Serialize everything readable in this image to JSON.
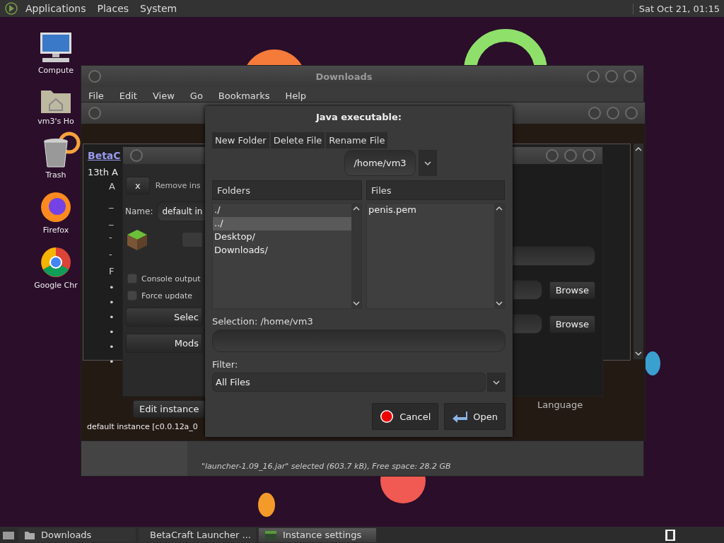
{
  "top_panel": {
    "menus": [
      "Applications",
      "Places",
      "System"
    ],
    "clock": "Sat Oct 21, 01:15"
  },
  "desktop_icons": [
    {
      "kind": "computer",
      "label": "Compute"
    },
    {
      "kind": "home",
      "label": "vm3's Ho"
    },
    {
      "kind": "trash",
      "label": "Trash"
    },
    {
      "kind": "firefox",
      "label": "Firefox"
    },
    {
      "kind": "chrome",
      "label": "Google Chr"
    }
  ],
  "downloads_window": {
    "title": "Downloads",
    "menu": [
      "File",
      "Edit",
      "View",
      "Go",
      "Bookmarks",
      "Help"
    ],
    "status": "\"launcher-1.09_16.jar\" selected (603.7 kB), Free space: 28.2 GB"
  },
  "launcher_window": {
    "link": "BetaC",
    "date": "13th A",
    "lines": [
      "A",
      "_",
      "_",
      "-",
      "-",
      "F"
    ],
    "bullets": [
      "•",
      "•",
      "•",
      "•",
      "•",
      "•"
    ],
    "edit_button": "Edit instance",
    "instance_label": "default instance [c0.0.12a_0",
    "language": "Language"
  },
  "settings_window": {
    "close_button": "x",
    "remove_label": "Remove ins",
    "name_label": "Name:",
    "name_value": "default in",
    "checkboxes": [
      {
        "label": "Console output",
        "checked": false
      },
      {
        "label": "Force update",
        "checked": false
      }
    ],
    "buttons": [
      "Selec",
      "Mods"
    ],
    "browse_buttons": [
      "Browse",
      "Browse"
    ]
  },
  "file_dialog": {
    "title": "Java executable:",
    "actions": [
      "New Folder",
      "Delete File",
      "Rename File"
    ],
    "path": "/home/vm3",
    "folders_header": "Folders",
    "files_header": "Files",
    "folders": [
      {
        "name": "./",
        "selected": false
      },
      {
        "name": "../",
        "selected": true
      },
      {
        "name": "Desktop/",
        "selected": false
      },
      {
        "name": "Downloads/",
        "selected": false
      }
    ],
    "files": [
      {
        "name": "penis.pem",
        "selected": false
      }
    ],
    "selection_label": "Selection: /home/vm3",
    "filter_label": "Filter:",
    "filter_value": "All Files",
    "cancel": "Cancel",
    "open": "Open"
  },
  "taskbar": [
    {
      "kind": "folder",
      "label": "Downloads",
      "selected": false
    },
    {
      "kind": "app",
      "label": "BetaCraft Launcher ...",
      "selected": false
    },
    {
      "kind": "app",
      "label": "Instance settings",
      "selected": true
    }
  ]
}
